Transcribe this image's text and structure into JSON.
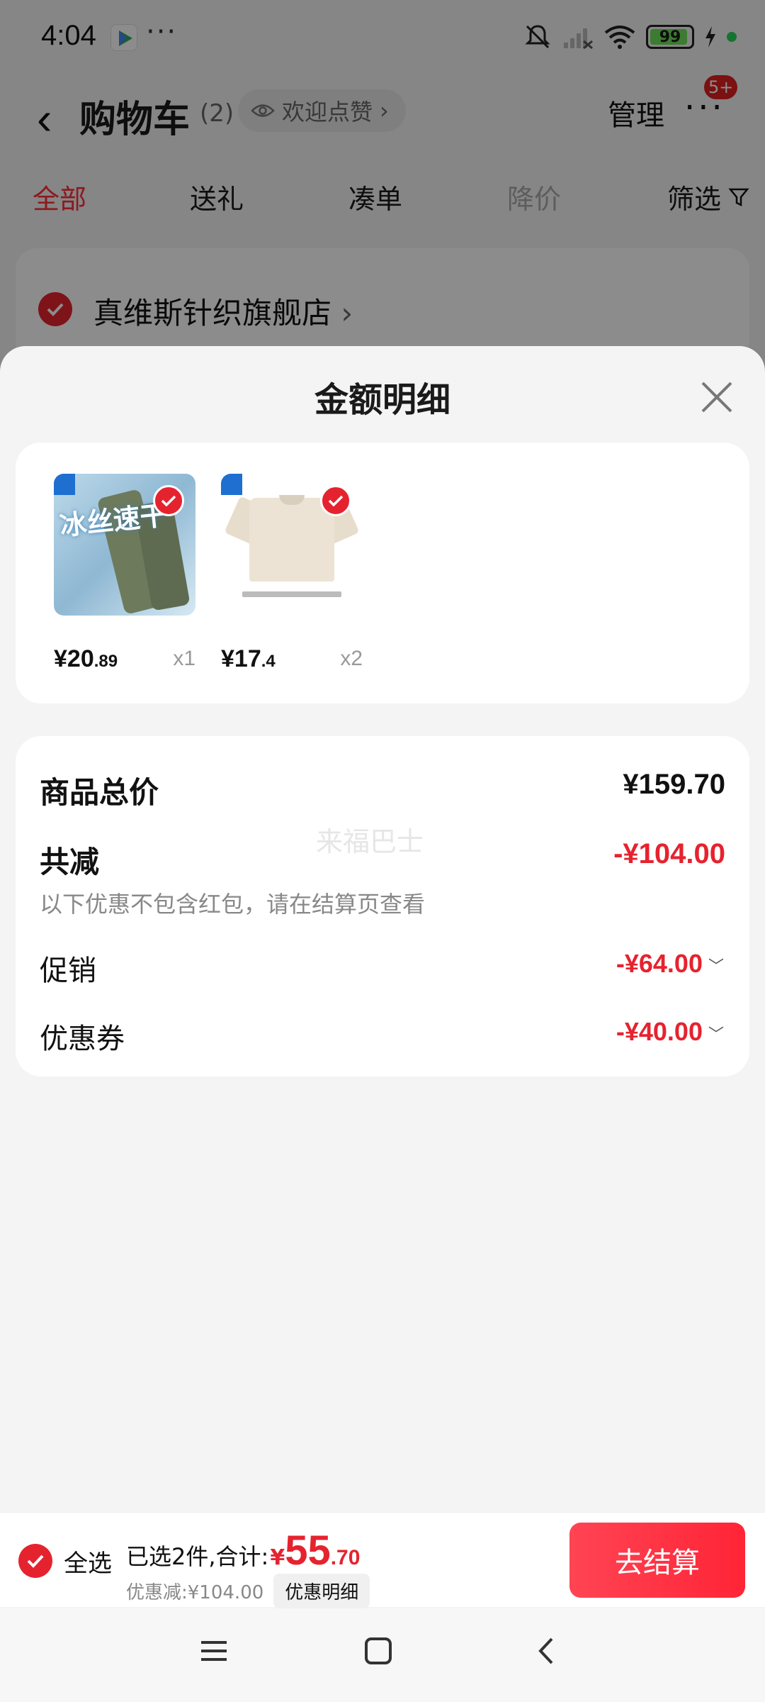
{
  "status_bar": {
    "time": "4:04",
    "more": "···",
    "battery": "99"
  },
  "header": {
    "title": "购物车",
    "count": "(2)",
    "like_pill": "欢迎点赞",
    "like_chevron": "›",
    "manage": "管理",
    "more": "···",
    "badge": "5+"
  },
  "tabs": [
    {
      "label": "全部"
    },
    {
      "label": "送礼"
    },
    {
      "label": "凑单"
    },
    {
      "label": "降价"
    }
  ],
  "filter_label": "筛选",
  "store": {
    "name": "真维斯针织旗舰店",
    "chevron": "›"
  },
  "sheet": {
    "title": "金额明细",
    "items": [
      {
        "price_int": "¥20",
        "price_dec": ".89",
        "qty": "x1",
        "image_text": "冰丝速干"
      },
      {
        "price_int": "¥17",
        "price_dec": ".4",
        "qty": "x2"
      }
    ],
    "summary": {
      "total_label": "商品总价",
      "total_value": "¥159.70",
      "reduce_label": "共减",
      "reduce_value": "-¥104.00",
      "note": "以下优惠不包含红包，请在结算页查看",
      "promo_label": "促销",
      "promo_value": "-¥64.00",
      "coupon_label": "优惠券",
      "coupon_value": "-¥40.00",
      "watermark": "来福巴士"
    }
  },
  "bottom_bar": {
    "select_all": "全选",
    "selected_text": "已选2件,合计:",
    "total_symbol": "¥",
    "total_int": "55",
    "total_dec": ".70",
    "discount_text": "优惠减:¥104.00",
    "detail_button": "优惠明细",
    "checkout": "去结算"
  },
  "colors": {
    "accent": "#e5232f",
    "checkout_gradient_start": "#ff4454",
    "checkout_gradient_end": "#ff2436"
  }
}
